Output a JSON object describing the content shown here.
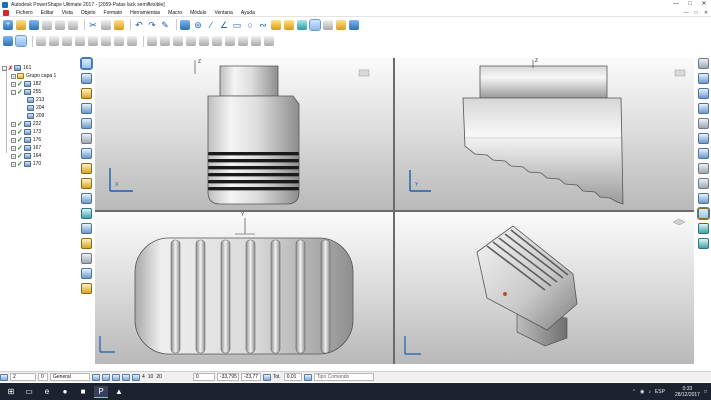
{
  "window": {
    "title": "Autodesk PowerShape Ultimate 2017 - [2059-Patas lack semiflexible]",
    "controls": [
      "—",
      "□",
      "✕"
    ]
  },
  "menu": {
    "items": [
      "Fichero",
      "Editar",
      "Vista",
      "Objeto",
      "Formato",
      "Herramientas",
      "Macro",
      "Módulo",
      "Ventana",
      "Ayuda"
    ]
  },
  "tree": {
    "root": "161",
    "items": [
      {
        "label": "Grupo capa 1",
        "checked": false,
        "type": "group"
      },
      {
        "label": "182",
        "checked": true,
        "type": "solid"
      },
      {
        "label": "255",
        "checked": true,
        "type": "solid"
      },
      {
        "label": "213",
        "checked": false,
        "type": "solid"
      },
      {
        "label": "204",
        "checked": false,
        "type": "solid"
      },
      {
        "label": "209",
        "checked": false,
        "type": "solid"
      },
      {
        "label": "222",
        "checked": true,
        "type": "solid"
      },
      {
        "label": "173",
        "checked": true,
        "type": "solid"
      },
      {
        "label": "176",
        "checked": true,
        "type": "solid"
      },
      {
        "label": "167",
        "checked": true,
        "type": "solid"
      },
      {
        "label": "164",
        "checked": true,
        "type": "solid"
      },
      {
        "label": "170",
        "checked": true,
        "type": "solid"
      }
    ]
  },
  "viewports": {
    "axis_z": "Z",
    "axis_x": "X",
    "axis_y": "Y"
  },
  "status": {
    "layer_value": "2",
    "layer_num": "0",
    "level_label": "General",
    "numbers": [
      "4",
      "10",
      "20"
    ],
    "coord_0": "0",
    "coord_x": "-33,795",
    "coord_y": "-23,77",
    "tol_label": "Tol.",
    "tol_value": "0,01",
    "command_placeholder": "Tipo Comando"
  },
  "taskbar": {
    "lang": "ESP",
    "time": "0:33",
    "date": "28/12/2017"
  },
  "colors": {
    "viewport_top": "#fbfbfb",
    "viewport_bottom": "#b9b9b9",
    "check_green": "#1a9a1a",
    "taskbar": "#1c2230"
  }
}
